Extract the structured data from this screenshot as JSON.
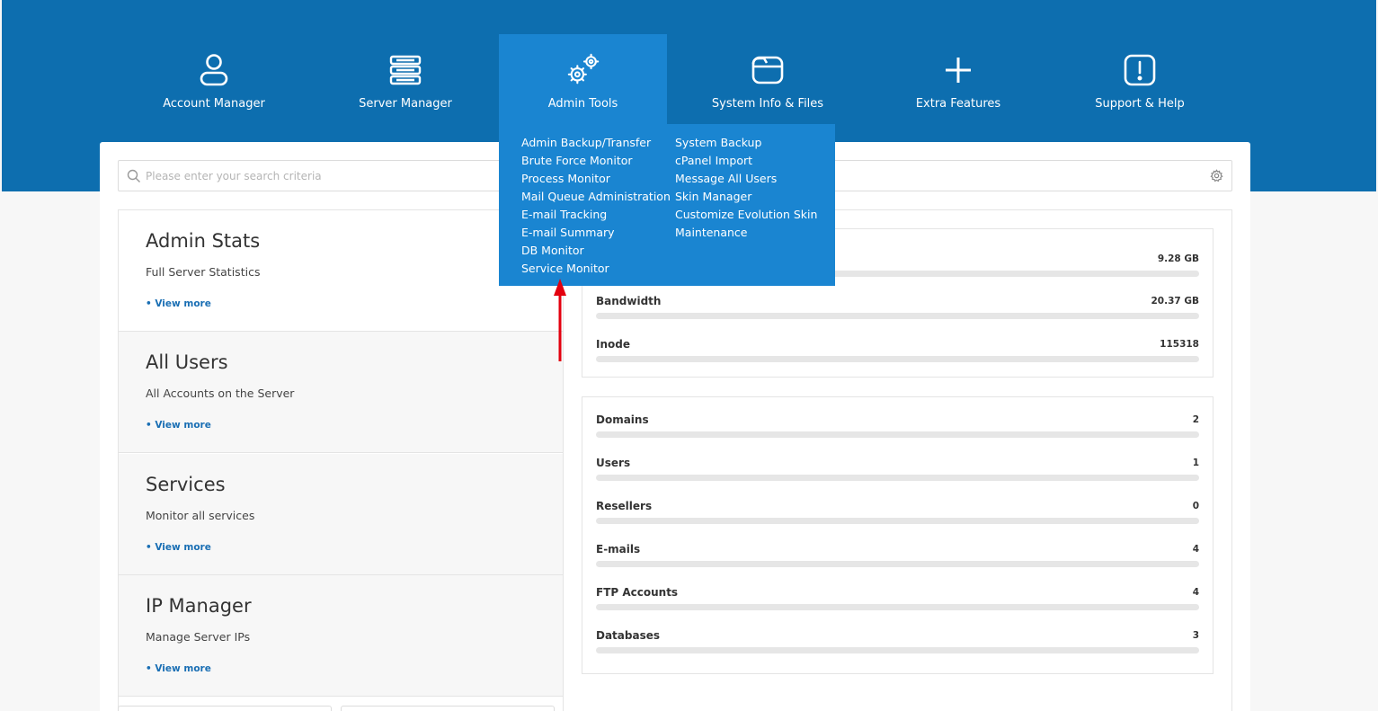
{
  "nav": {
    "items": [
      {
        "label": "Account Manager",
        "icon": "user-icon"
      },
      {
        "label": "Server Manager",
        "icon": "server-icon"
      },
      {
        "label": "Admin Tools",
        "icon": "gears-icon"
      },
      {
        "label": "System Info & Files",
        "icon": "folder-icon"
      },
      {
        "label": "Extra Features",
        "icon": "plus-icon"
      },
      {
        "label": "Support & Help",
        "icon": "alert-icon"
      }
    ]
  },
  "admin_menu": {
    "col1": [
      "Admin Backup/Transfer",
      "Brute Force Monitor",
      "Process Monitor",
      "Mail Queue Administration",
      "E-mail Tracking",
      "E-mail Summary",
      "DB Monitor",
      "Service Monitor"
    ],
    "col2": [
      "System Backup",
      "cPanel Import",
      "Message All Users",
      "Skin Manager",
      "Customize Evolution Skin",
      "Maintenance"
    ]
  },
  "search": {
    "placeholder": "Please enter your search criteria"
  },
  "sections": [
    {
      "title": "Admin Stats",
      "desc": "Full Server Statistics",
      "link": "• View more"
    },
    {
      "title": "All Users",
      "desc": "All Accounts on the Server",
      "link": "• View more"
    },
    {
      "title": "Services",
      "desc": "Monitor all services",
      "link": "• View more"
    },
    {
      "title": "IP Manager",
      "desc": "Manage Server IPs",
      "link": "• View more"
    }
  ],
  "usage": {
    "disk": {
      "value": "9.28 GB"
    },
    "bandwidth": {
      "name": "Bandwidth",
      "value": "20.37 GB"
    },
    "inode": {
      "name": "Inode",
      "value": "115318"
    }
  },
  "counts": [
    {
      "name": "Domains",
      "value": "2"
    },
    {
      "name": "Users",
      "value": "1"
    },
    {
      "name": "Resellers",
      "value": "0"
    },
    {
      "name": "E-mails",
      "value": "4"
    },
    {
      "name": "FTP Accounts",
      "value": "4"
    },
    {
      "name": "Databases",
      "value": "3"
    }
  ],
  "colors": {
    "header": "#0d6eaf",
    "active": "#1a85d1",
    "link": "#1a6fb4",
    "arrow": "#e3000f"
  }
}
